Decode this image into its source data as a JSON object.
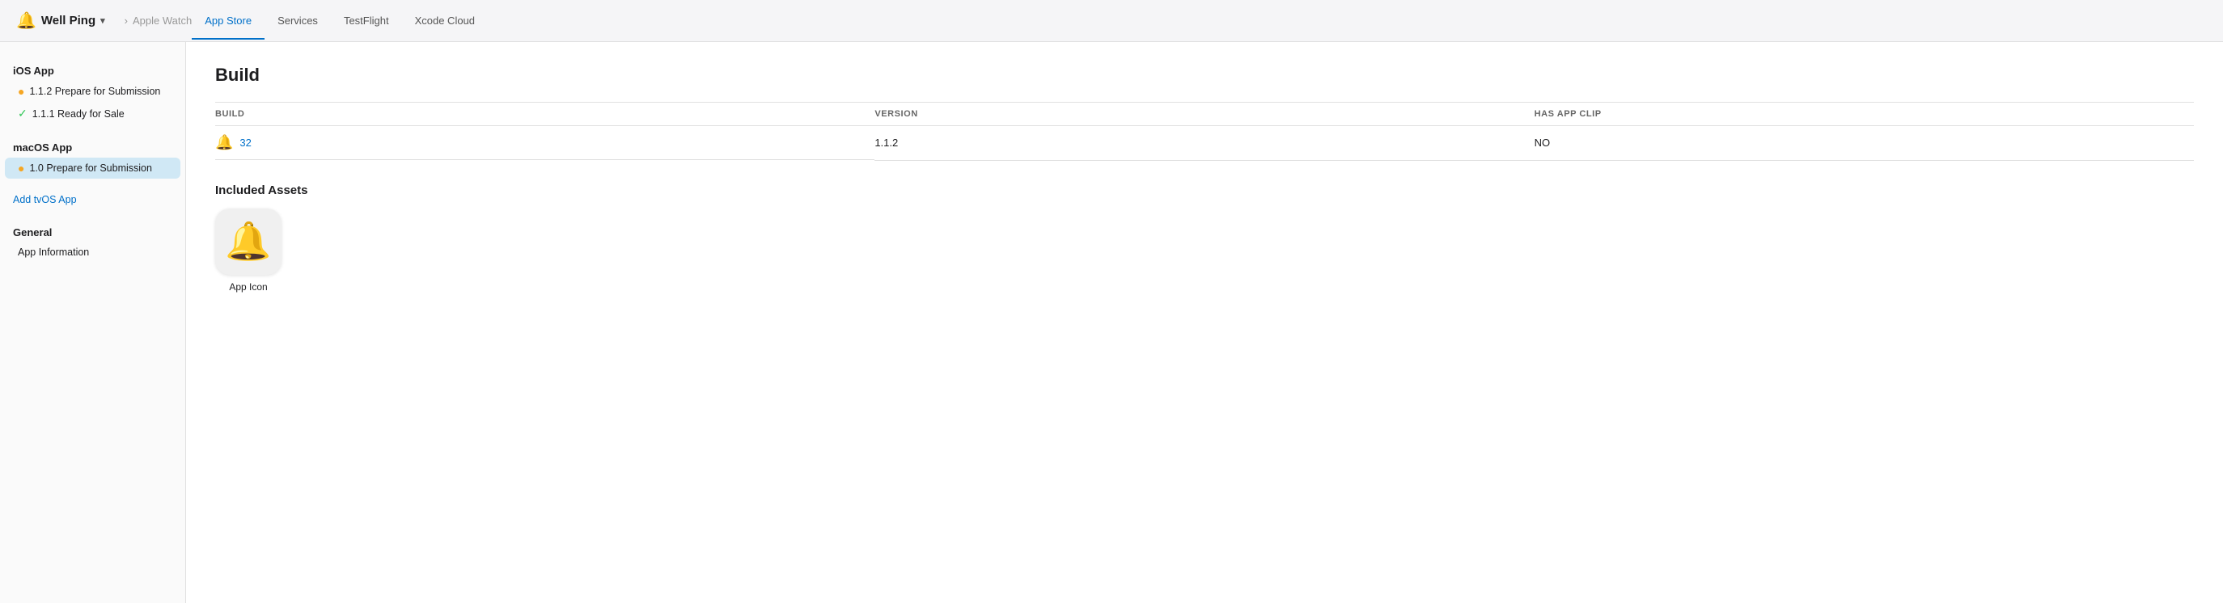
{
  "app": {
    "name": "Well Ping",
    "icon": "🔔"
  },
  "nav": {
    "breadcrumb_inactive": "Apple Watch",
    "breadcrumb_separator": "›",
    "tabs": [
      {
        "id": "app-store",
        "label": "App Store",
        "active": true
      },
      {
        "id": "services",
        "label": "Services",
        "active": false
      },
      {
        "id": "testflight",
        "label": "TestFlight",
        "active": false
      },
      {
        "id": "xcode-cloud",
        "label": "Xcode Cloud",
        "active": false
      }
    ]
  },
  "sidebar": {
    "ios_section_title": "iOS App",
    "ios_items": [
      {
        "id": "ios-112",
        "label": "1.1.2 Prepare for Submission",
        "status": "yellow",
        "active": false
      },
      {
        "id": "ios-111",
        "label": "1.1.1 Ready for Sale",
        "status": "green",
        "active": false
      }
    ],
    "macos_section_title": "macOS App",
    "macos_items": [
      {
        "id": "macos-10",
        "label": "1.0 Prepare for Submission",
        "status": "yellow",
        "active": true
      }
    ],
    "add_tvos_label": "Add tvOS App",
    "general_section_title": "General",
    "general_item": "App Information"
  },
  "build_section": {
    "title": "Build",
    "table_headers": {
      "build": "BUILD",
      "version": "VERSION",
      "has_app_clip": "HAS APP CLIP"
    },
    "row": {
      "icon": "🔔",
      "build_number": "32",
      "version": "1.1.2",
      "has_app_clip": "NO"
    }
  },
  "included_assets": {
    "title": "Included Assets",
    "items": [
      {
        "id": "app-icon",
        "icon": "🔔",
        "label": "App Icon"
      }
    ]
  }
}
